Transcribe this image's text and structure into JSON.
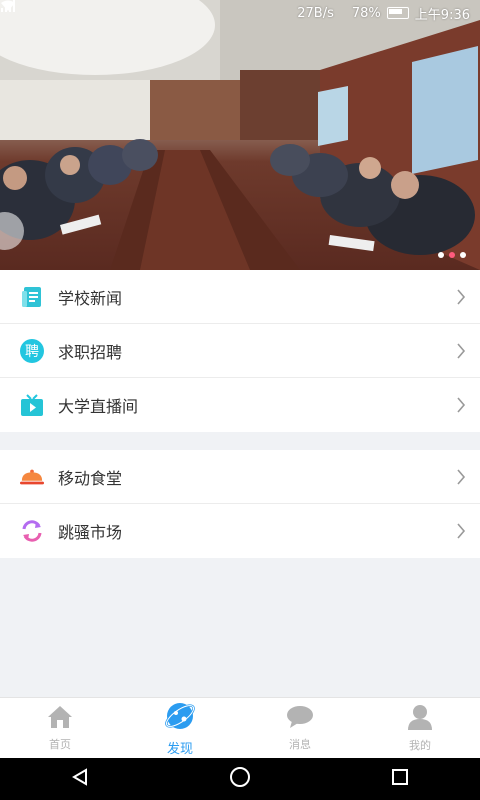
{
  "status_bar": {
    "carrier": "",
    "speed": "27B/s",
    "battery": "78%",
    "time": "上午9:36"
  },
  "banner": {
    "image": "conference-room-meeting-photo",
    "pager_count": 3,
    "active_index": 1
  },
  "menu_group_1": [
    {
      "label": "学校新闻",
      "icon": "news-icon",
      "color": "#2fc3d6"
    },
    {
      "label": "求职招聘",
      "icon": "recruit-icon",
      "color": "#22c6e0"
    },
    {
      "label": "大学直播间",
      "icon": "tv-icon",
      "color": "#25c4d6"
    }
  ],
  "menu_group_2": [
    {
      "label": "移动食堂",
      "icon": "cloche-icon",
      "color": "#f26b3a"
    },
    {
      "label": "跳骚市场",
      "icon": "exchange-icon",
      "color": "#b46cf0"
    }
  ],
  "recruit_icon_char": "聘",
  "bottom_nav": [
    {
      "label": "首页",
      "icon": "home-icon",
      "active": false
    },
    {
      "label": "发现",
      "icon": "discover-icon",
      "active": true
    },
    {
      "label": "消息",
      "icon": "message-icon",
      "active": false
    },
    {
      "label": "我的",
      "icon": "user-icon",
      "active": false
    }
  ],
  "colors": {
    "accent": "#2b9cf0",
    "inactive": "#b3b3b3",
    "background": "#f0f2f5"
  }
}
